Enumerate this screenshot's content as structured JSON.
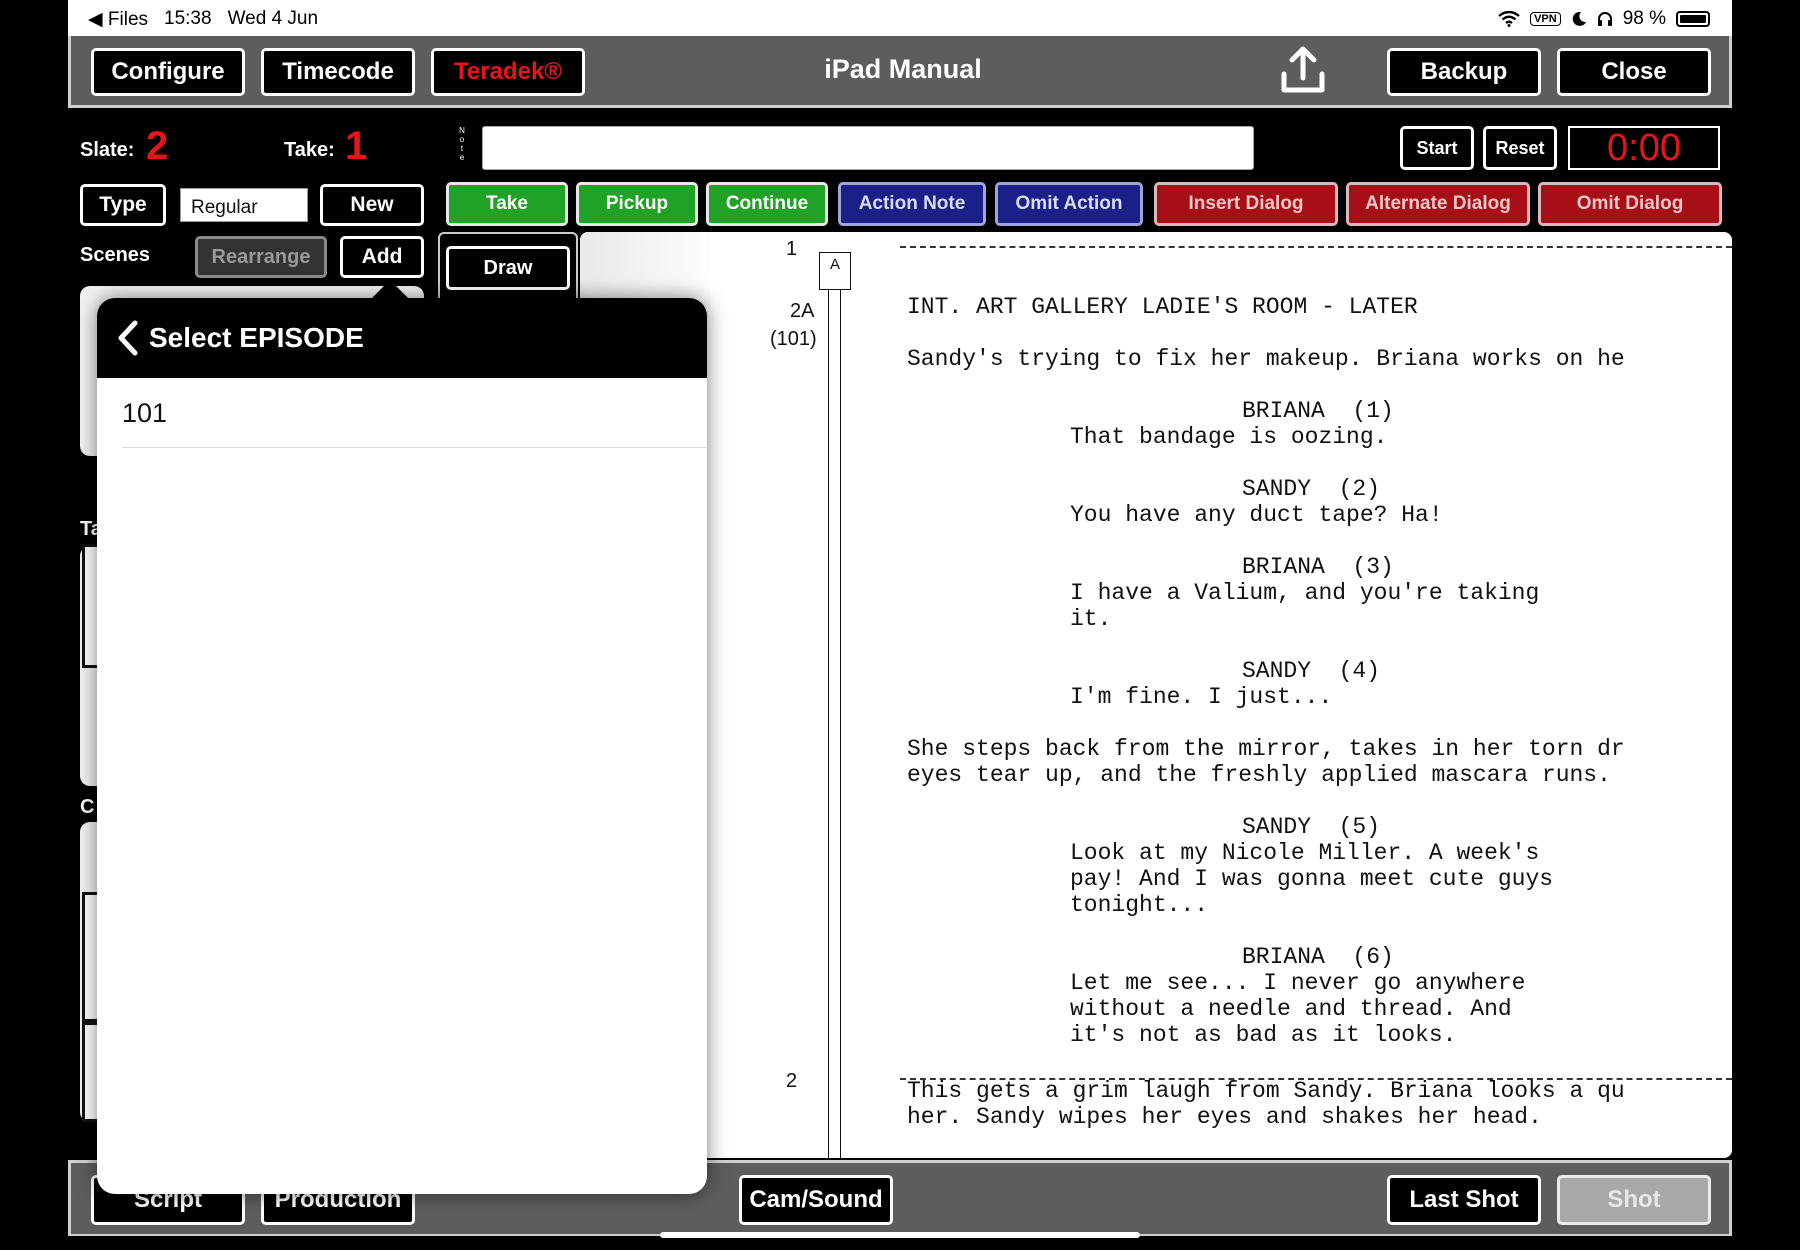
{
  "status_bar": {
    "back_app": "◀ Files",
    "time": "15:38",
    "date": "Wed 4 Jun",
    "vpn": "VPN",
    "battery": "98 %"
  },
  "header": {
    "title": "iPad Manual",
    "configure": "Configure",
    "timecode": "Timecode",
    "teradek": "Teradek®",
    "backup": "Backup",
    "close": "Close"
  },
  "slate": {
    "slate_label": "Slate:",
    "slate_value": "2",
    "take_label": "Take:",
    "take_value": "1"
  },
  "note": {
    "label": "Note",
    "value": ""
  },
  "timer": {
    "start": "Start",
    "reset": "Reset",
    "value": "0:00"
  },
  "type_row": {
    "type_label": "Type",
    "type_value": "Regular",
    "new_label": "New"
  },
  "scenes_row": {
    "scenes_label": "Scenes",
    "rearrange": "Rearrange",
    "add": "Add"
  },
  "actions": {
    "take": "Take",
    "pickup": "Pickup",
    "continue": "Continue",
    "action_note": "Action Note",
    "omit_action": "Omit Action",
    "insert_dialog": "Insert Dialog",
    "alternate_dialog": "Alternate Dialog",
    "omit_dialog": "Omit Dialog"
  },
  "draw": "Draw",
  "colors": {
    "red": "#e8141a",
    "green": "#1fa226",
    "blue": "#1a2088",
    "dark_red": "#a50f15",
    "bar_gray": "#5d5d5d"
  },
  "script": {
    "page_top": "1",
    "page_bottom": "2",
    "a_marker": "A",
    "scene_number": "2A",
    "scene_episode": "(101)",
    "lines": {
      "heading": "INT. ART GALLERY LADIE'S ROOM - LATER",
      "action1": "Sandy's trying to fix her makeup. Briana works on he",
      "char1": "BRIANA  (1)",
      "dlg1": "That bandage is oozing.",
      "char2": "SANDY  (2)",
      "dlg2": "You have any duct tape? Ha!",
      "char3": "BRIANA  (3)",
      "dlg3a": "I have a Valium, and you're taking",
      "dlg3b": "it.",
      "char4": "SANDY  (4)",
      "dlg4": "I'm fine. I just...",
      "action2a": "She steps back from the mirror, takes in her torn dr",
      "action2b": "eyes tear up, and the freshly applied mascara runs.",
      "char5": "SANDY  (5)",
      "dlg5a": "Look at my Nicole Miller. A week's",
      "dlg5b": "pay! And I was gonna meet cute guys",
      "dlg5c": "tonight...",
      "char6": "BRIANA  (6)",
      "dlg6a": "Let me see... I never go anywhere",
      "dlg6b": "without a needle and thread. And",
      "dlg6c": "it's not as bad as it looks.",
      "action3a": "This gets a grim laugh from Sandy. Briana looks a qu",
      "action3b": "her. Sandy wipes her eyes and shakes her head."
    }
  },
  "bottom": {
    "script": "Script",
    "production": "Production",
    "cam_sound": "Cam/Sound",
    "last_shot": "Last Shot",
    "shot": "Shot"
  },
  "popover": {
    "title": "Select EPISODE",
    "items": [
      "101"
    ]
  }
}
